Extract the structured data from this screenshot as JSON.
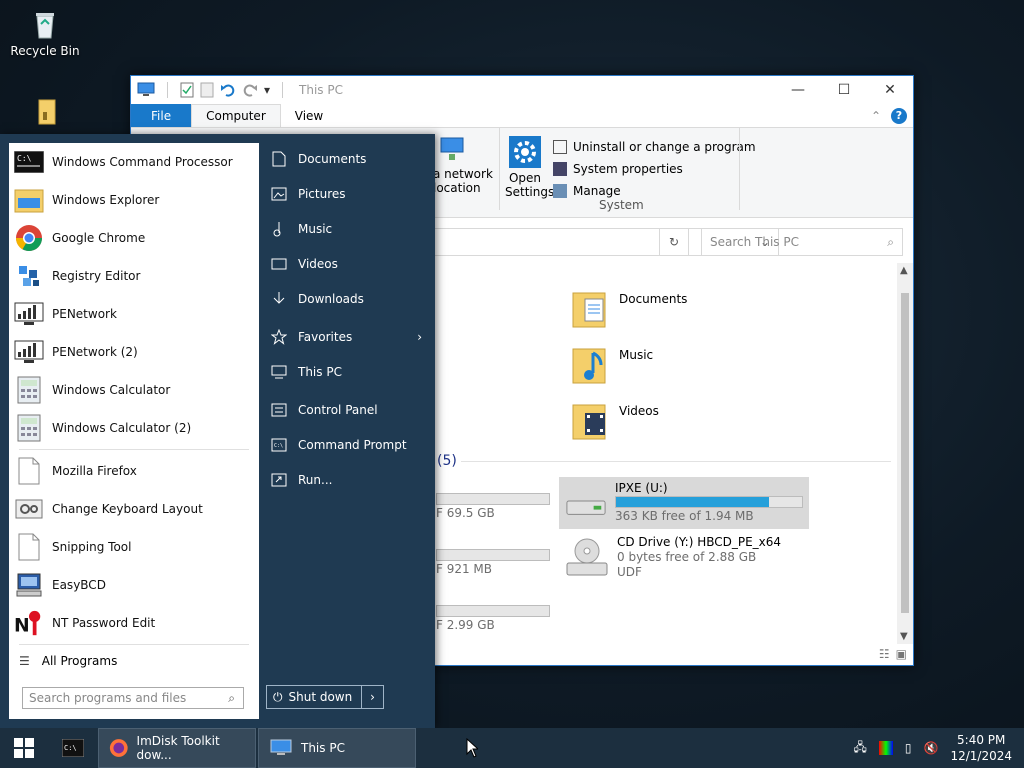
{
  "desktop": {
    "icons": [
      {
        "label": "Recycle Bin",
        "icon": "recycle-bin-icon"
      }
    ]
  },
  "explorer": {
    "title": "This PC",
    "tabs": [
      "File",
      "Computer",
      "View"
    ],
    "ribbon": {
      "network_text_1": "a network",
      "network_text_2": "location",
      "open_settings_1": "Open",
      "open_settings_2": "Settings",
      "uninstall": "Uninstall or change a program",
      "system_properties": "System properties",
      "manage": "Manage",
      "group_label": "System"
    },
    "search_placeholder": "Search This PC",
    "folders": [
      {
        "label": "Documents",
        "icon": "documents-folder-icon"
      },
      {
        "label": "Music",
        "icon": "music-folder-icon"
      },
      {
        "label": "Videos",
        "icon": "videos-folder-icon"
      }
    ],
    "devices_header": "(5)",
    "left_drives": [
      {
        "meta": "F 69.5 GB"
      },
      {
        "meta": "F 921 MB"
      },
      {
        "meta": "F 2.99 GB"
      }
    ],
    "drives": [
      {
        "name": "IPXE (U:)",
        "meta": "363 KB free of 1.94 MB",
        "fill_fraction": 0.82,
        "selected": true
      },
      {
        "name": "CD Drive (Y:) HBCD_PE_x64",
        "meta": "0 bytes free of 2.88 GB",
        "meta2": "UDF"
      }
    ]
  },
  "start_menu": {
    "apps": [
      {
        "label": "Windows Command Processor",
        "icon": "cmd-icon"
      },
      {
        "label": "Windows Explorer",
        "icon": "explorer-icon"
      },
      {
        "label": "Google Chrome",
        "icon": "chrome-icon"
      },
      {
        "label": "Registry Editor",
        "icon": "regedit-icon"
      },
      {
        "label": "PENetwork",
        "icon": "network-icon"
      },
      {
        "label": "PENetwork (2)",
        "icon": "network-icon"
      },
      {
        "label": "Windows Calculator",
        "icon": "calculator-icon"
      },
      {
        "label": "Windows Calculator (2)",
        "icon": "calculator-icon"
      }
    ],
    "apps2": [
      {
        "label": "Mozilla Firefox",
        "icon": "document-icon"
      },
      {
        "label": "Change Keyboard Layout",
        "icon": "keyboard-icon"
      },
      {
        "label": "Snipping Tool",
        "icon": "document-icon"
      },
      {
        "label": "EasyBCD",
        "icon": "easybcd-icon"
      },
      {
        "label": "NT Password Edit",
        "icon": "nt-password-icon"
      }
    ],
    "all_programs": "All Programs",
    "search_placeholder": "Search programs and files",
    "places": [
      {
        "label": "Documents",
        "icon": "document-icon"
      },
      {
        "label": "Pictures",
        "icon": "pictures-icon"
      },
      {
        "label": "Music",
        "icon": "music-note-icon"
      },
      {
        "label": "Videos",
        "icon": "film-icon"
      },
      {
        "label": "Downloads",
        "icon": "download-icon"
      },
      {
        "label": "Favorites",
        "icon": "star-icon"
      },
      {
        "label": "This PC",
        "icon": "computer-icon"
      },
      {
        "label": "Control Panel",
        "icon": "control-panel-icon"
      },
      {
        "label": "Command Prompt",
        "icon": "terminal-icon"
      },
      {
        "label": "Run...",
        "icon": "run-icon"
      }
    ],
    "shutdown": "Shut down"
  },
  "taskbar": {
    "items": [
      {
        "label": "ImDisk Toolkit dow...",
        "icon": "firefox-icon"
      },
      {
        "label": "This PC",
        "icon": "computer-icon"
      }
    ],
    "time": "5:40 PM",
    "date": "12/1/2024"
  },
  "colors": {
    "accent": "#1979ca",
    "start_bg": "#1f3a52",
    "taskbar_bg": "#1c2f3f",
    "drive_bar": "#26a0da"
  }
}
